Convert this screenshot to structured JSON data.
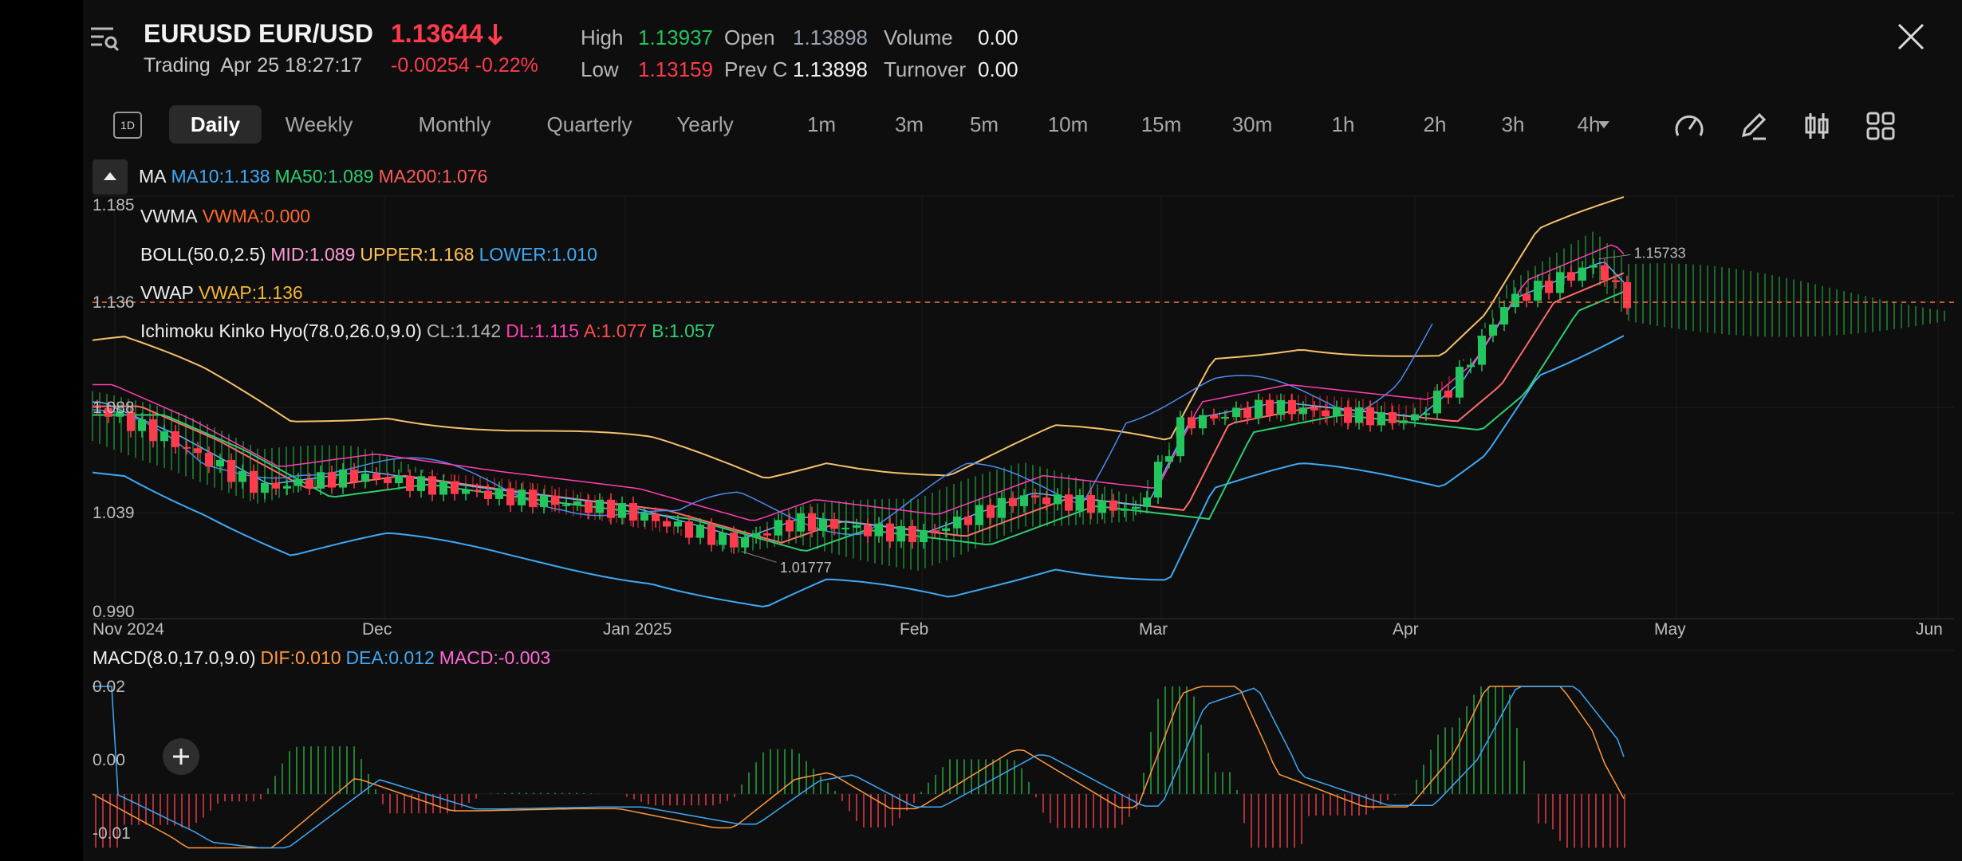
{
  "header": {
    "symbol": "EURUSD",
    "pair": "EUR/USD",
    "price": "1.13644",
    "status": "Trading",
    "datetime": "Apr 25 18:27:17",
    "change": "-0.00254",
    "change_pct": "-0.22%",
    "stats": {
      "high_label": "High",
      "high": "1.13937",
      "low_label": "Low",
      "low": "1.13159",
      "open_label": "Open",
      "open": "1.13898",
      "prevc_label": "Prev C",
      "prevc": "1.13898",
      "volume_label": "Volume",
      "volume": "0.00",
      "turnover_label": "Turnover",
      "turnover": "0.00"
    },
    "colors": {
      "down": "#ff3b4d",
      "up": "#22c55e",
      "neutral": "#9aa4b2"
    }
  },
  "timeframe_bar": {
    "mode_icon_label": "1D",
    "items": [
      "Daily",
      "Weekly",
      "Monthly",
      "Quarterly",
      "Yearly",
      "1m",
      "3m",
      "5m",
      "10m",
      "15m",
      "30m",
      "1h",
      "2h",
      "3h",
      "4h"
    ],
    "selected": "Daily"
  },
  "toolbar_icons": [
    "gauge-icon",
    "pen-icon",
    "candles-icon",
    "grid-icon"
  ],
  "indicators": {
    "ma": {
      "name": "MA",
      "ma10": "MA10:1.138",
      "ma50": "MA50:1.089",
      "ma200": "MA200:1.076"
    },
    "vwma": {
      "name": "VWMA",
      "value": "VWMA:0.000"
    },
    "boll": {
      "name": "BOLL(50.0,2.5)",
      "mid": "MID:1.089",
      "upper": "UPPER:1.168",
      "lower": "LOWER:1.010"
    },
    "vwap": {
      "name": "VWAP",
      "value": "VWAP:1.136"
    },
    "ichimoku": {
      "name": "Ichimoku Kinko Hyo(78.0,26.0,9.0)",
      "cl": "CL:1.142",
      "dl": "DL:1.115",
      "a": "A:1.077",
      "b": "B:1.057"
    },
    "macd": {
      "name": "MACD(8.0,17.0,9.0)",
      "dif": "DIF:0.010",
      "dea": "DEA:0.012",
      "macd": "MACD:-0.003"
    }
  },
  "price_axis": {
    "top": "1.185",
    "current": "1.136",
    "mid": "1.088",
    "low": "1.039",
    "bottom": "0.990"
  },
  "macd_axis": {
    "top": "0.02",
    "mid": "0.00",
    "bottom": "-0.01"
  },
  "time_axis": [
    "Nov 2024",
    "Dec",
    "Jan 2025",
    "Feb",
    "Mar",
    "Apr",
    "May",
    "Jun"
  ],
  "annotations": {
    "high_marker": "1.15733",
    "low_marker": "1.01777"
  },
  "chart_data": {
    "type": "candlestick",
    "ylim": [
      0.99,
      1.185
    ],
    "x_range": [
      "2024-11-01",
      "2025-06-01"
    ],
    "current_price": 1.136,
    "close_series_approx": [
      {
        "date": "2024-11-01",
        "value": 1.088
      },
      {
        "date": "2024-11-10",
        "value": 1.072
      },
      {
        "date": "2024-11-20",
        "value": 1.05
      },
      {
        "date": "2024-12-01",
        "value": 1.056
      },
      {
        "date": "2024-12-15",
        "value": 1.048
      },
      {
        "date": "2024-12-31",
        "value": 1.04
      },
      {
        "date": "2025-01-13",
        "value": 1.025
      },
      {
        "date": "2025-01-20",
        "value": 1.035
      },
      {
        "date": "2025-02-03",
        "value": 1.028
      },
      {
        "date": "2025-02-15",
        "value": 1.046
      },
      {
        "date": "2025-02-28",
        "value": 1.04
      },
      {
        "date": "2025-03-05",
        "value": 1.08
      },
      {
        "date": "2025-03-15",
        "value": 1.088
      },
      {
        "date": "2025-03-31",
        "value": 1.081
      },
      {
        "date": "2025-04-05",
        "value": 1.098
      },
      {
        "date": "2025-04-11",
        "value": 1.136
      },
      {
        "date": "2025-04-21",
        "value": 1.153
      },
      {
        "date": "2025-04-25",
        "value": 1.136
      }
    ],
    "macd_ylim": [
      -0.01,
      0.02
    ]
  }
}
